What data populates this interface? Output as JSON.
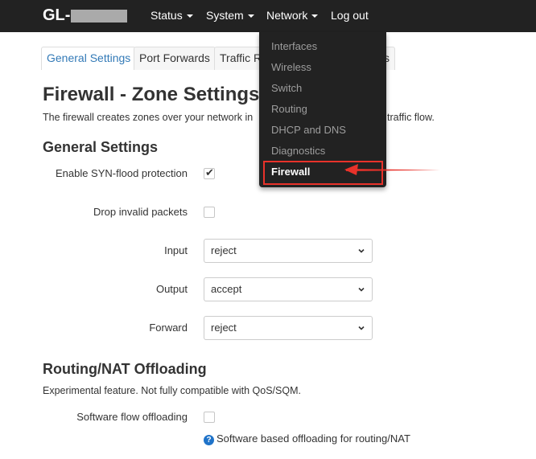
{
  "navbar": {
    "brand": "GL-",
    "menus": [
      {
        "label": "Status",
        "has_caret": true
      },
      {
        "label": "System",
        "has_caret": true
      },
      {
        "label": "Network",
        "has_caret": true
      },
      {
        "label": "Log out",
        "has_caret": false
      }
    ]
  },
  "tabs": [
    {
      "label": "General Settings",
      "active": true
    },
    {
      "label": "Port Forwards",
      "active": false
    },
    {
      "label": "Traffic R",
      "active": false
    },
    {
      "label": "s",
      "active": false
    }
  ],
  "page": {
    "title": "Firewall - Zone Settings",
    "description_left": "The firewall creates zones over your network in",
    "description_right": "traffic flow."
  },
  "general_settings": {
    "title": "General Settings",
    "syn_flood": {
      "label": "Enable SYN-flood protection",
      "checked": true
    },
    "drop_invalid": {
      "label": "Drop invalid packets",
      "checked": false
    },
    "input": {
      "label": "Input",
      "value": "reject"
    },
    "output": {
      "label": "Output",
      "value": "accept"
    },
    "forward": {
      "label": "Forward",
      "value": "reject"
    }
  },
  "offloading": {
    "title": "Routing/NAT Offloading",
    "description": "Experimental feature. Not fully compatible with QoS/SQM.",
    "software_flow": {
      "label": "Software flow offloading",
      "checked": false
    },
    "hint": "Software based offloading for routing/NAT",
    "hint_icon": "?"
  },
  "network_dropdown": {
    "items": [
      {
        "label": "Interfaces",
        "active": false
      },
      {
        "label": "Wireless",
        "active": false
      },
      {
        "label": "Switch",
        "active": false
      },
      {
        "label": "Routing",
        "active": false
      },
      {
        "label": "DHCP and DNS",
        "active": false
      },
      {
        "label": "Diagnostics",
        "active": false
      },
      {
        "label": "Firewall",
        "active": true
      }
    ]
  },
  "colors": {
    "navbar": "#222222",
    "link": "#337ab7",
    "annotation": "#e8322a"
  }
}
